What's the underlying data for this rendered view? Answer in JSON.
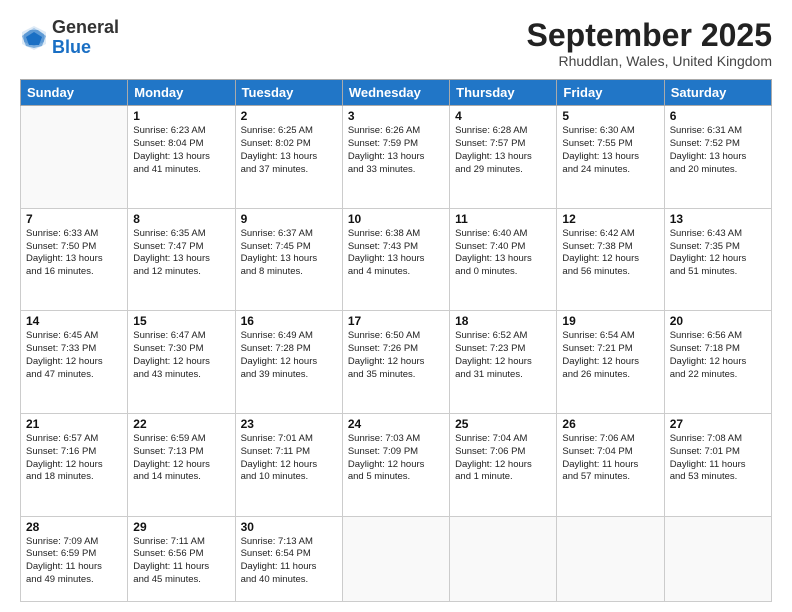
{
  "logo": {
    "general": "General",
    "blue": "Blue"
  },
  "title": "September 2025",
  "location": "Rhuddlan, Wales, United Kingdom",
  "days_of_week": [
    "Sunday",
    "Monday",
    "Tuesday",
    "Wednesday",
    "Thursday",
    "Friday",
    "Saturday"
  ],
  "weeks": [
    [
      {
        "day": "",
        "info": ""
      },
      {
        "day": "1",
        "info": "Sunrise: 6:23 AM\nSunset: 8:04 PM\nDaylight: 13 hours\nand 41 minutes."
      },
      {
        "day": "2",
        "info": "Sunrise: 6:25 AM\nSunset: 8:02 PM\nDaylight: 13 hours\nand 37 minutes."
      },
      {
        "day": "3",
        "info": "Sunrise: 6:26 AM\nSunset: 7:59 PM\nDaylight: 13 hours\nand 33 minutes."
      },
      {
        "day": "4",
        "info": "Sunrise: 6:28 AM\nSunset: 7:57 PM\nDaylight: 13 hours\nand 29 minutes."
      },
      {
        "day": "5",
        "info": "Sunrise: 6:30 AM\nSunset: 7:55 PM\nDaylight: 13 hours\nand 24 minutes."
      },
      {
        "day": "6",
        "info": "Sunrise: 6:31 AM\nSunset: 7:52 PM\nDaylight: 13 hours\nand 20 minutes."
      }
    ],
    [
      {
        "day": "7",
        "info": "Sunrise: 6:33 AM\nSunset: 7:50 PM\nDaylight: 13 hours\nand 16 minutes."
      },
      {
        "day": "8",
        "info": "Sunrise: 6:35 AM\nSunset: 7:47 PM\nDaylight: 13 hours\nand 12 minutes."
      },
      {
        "day": "9",
        "info": "Sunrise: 6:37 AM\nSunset: 7:45 PM\nDaylight: 13 hours\nand 8 minutes."
      },
      {
        "day": "10",
        "info": "Sunrise: 6:38 AM\nSunset: 7:43 PM\nDaylight: 13 hours\nand 4 minutes."
      },
      {
        "day": "11",
        "info": "Sunrise: 6:40 AM\nSunset: 7:40 PM\nDaylight: 13 hours\nand 0 minutes."
      },
      {
        "day": "12",
        "info": "Sunrise: 6:42 AM\nSunset: 7:38 PM\nDaylight: 12 hours\nand 56 minutes."
      },
      {
        "day": "13",
        "info": "Sunrise: 6:43 AM\nSunset: 7:35 PM\nDaylight: 12 hours\nand 51 minutes."
      }
    ],
    [
      {
        "day": "14",
        "info": "Sunrise: 6:45 AM\nSunset: 7:33 PM\nDaylight: 12 hours\nand 47 minutes."
      },
      {
        "day": "15",
        "info": "Sunrise: 6:47 AM\nSunset: 7:30 PM\nDaylight: 12 hours\nand 43 minutes."
      },
      {
        "day": "16",
        "info": "Sunrise: 6:49 AM\nSunset: 7:28 PM\nDaylight: 12 hours\nand 39 minutes."
      },
      {
        "day": "17",
        "info": "Sunrise: 6:50 AM\nSunset: 7:26 PM\nDaylight: 12 hours\nand 35 minutes."
      },
      {
        "day": "18",
        "info": "Sunrise: 6:52 AM\nSunset: 7:23 PM\nDaylight: 12 hours\nand 31 minutes."
      },
      {
        "day": "19",
        "info": "Sunrise: 6:54 AM\nSunset: 7:21 PM\nDaylight: 12 hours\nand 26 minutes."
      },
      {
        "day": "20",
        "info": "Sunrise: 6:56 AM\nSunset: 7:18 PM\nDaylight: 12 hours\nand 22 minutes."
      }
    ],
    [
      {
        "day": "21",
        "info": "Sunrise: 6:57 AM\nSunset: 7:16 PM\nDaylight: 12 hours\nand 18 minutes."
      },
      {
        "day": "22",
        "info": "Sunrise: 6:59 AM\nSunset: 7:13 PM\nDaylight: 12 hours\nand 14 minutes."
      },
      {
        "day": "23",
        "info": "Sunrise: 7:01 AM\nSunset: 7:11 PM\nDaylight: 12 hours\nand 10 minutes."
      },
      {
        "day": "24",
        "info": "Sunrise: 7:03 AM\nSunset: 7:09 PM\nDaylight: 12 hours\nand 5 minutes."
      },
      {
        "day": "25",
        "info": "Sunrise: 7:04 AM\nSunset: 7:06 PM\nDaylight: 12 hours\nand 1 minute."
      },
      {
        "day": "26",
        "info": "Sunrise: 7:06 AM\nSunset: 7:04 PM\nDaylight: 11 hours\nand 57 minutes."
      },
      {
        "day": "27",
        "info": "Sunrise: 7:08 AM\nSunset: 7:01 PM\nDaylight: 11 hours\nand 53 minutes."
      }
    ],
    [
      {
        "day": "28",
        "info": "Sunrise: 7:09 AM\nSunset: 6:59 PM\nDaylight: 11 hours\nand 49 minutes."
      },
      {
        "day": "29",
        "info": "Sunrise: 7:11 AM\nSunset: 6:56 PM\nDaylight: 11 hours\nand 45 minutes."
      },
      {
        "day": "30",
        "info": "Sunrise: 7:13 AM\nSunset: 6:54 PM\nDaylight: 11 hours\nand 40 minutes."
      },
      {
        "day": "",
        "info": ""
      },
      {
        "day": "",
        "info": ""
      },
      {
        "day": "",
        "info": ""
      },
      {
        "day": "",
        "info": ""
      }
    ]
  ]
}
